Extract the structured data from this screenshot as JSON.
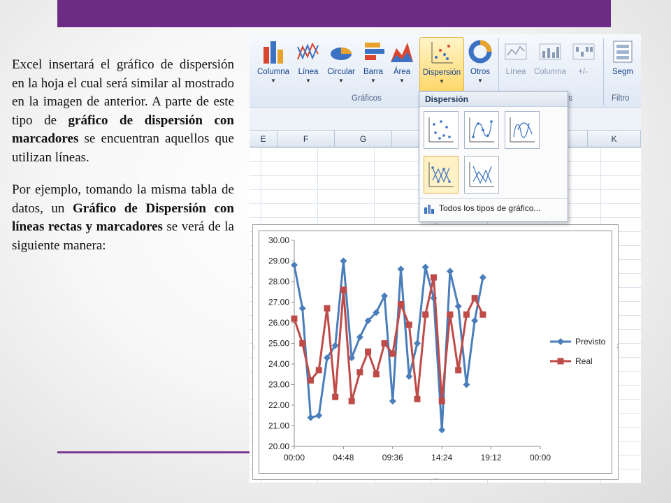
{
  "slide": {
    "paragraph1": [
      {
        "text": "Excel insertará el gráfico de dispersión en la hoja el cual será similar al mostrado en la imagen de anterior. A parte de este tipo de ",
        "bold": false
      },
      {
        "text": "gráfico de dispersión con marcadores",
        "bold": true
      },
      {
        "text": " se encuentran aquellos que utilizan líneas.",
        "bold": false
      }
    ],
    "paragraph2": [
      {
        "text": "Por ejemplo, tomando la misma tabla de datos, un ",
        "bold": false
      },
      {
        "text": "Gráfico de Dispersión con líneas rectas y marcadores",
        "bold": true
      },
      {
        "text": " se verá de la siguiente manera:",
        "bold": false
      }
    ],
    "accent_color": "#6c2c85"
  },
  "ribbon": {
    "buttons": [
      "Columna",
      "Línea",
      "Circular",
      "Barra",
      "Área",
      "Dispersión",
      "Otros"
    ],
    "sparklines": [
      "Línea",
      "Columna",
      "+/-"
    ],
    "filter_button": "Segm",
    "group_charts": "Gráficos",
    "group_sparklines_tail": "os",
    "group_filter": "Filtro"
  },
  "columns": [
    "E",
    "F",
    "G",
    "K"
  ],
  "dropdown": {
    "title": "Dispersión",
    "all_types_link": "Todos los tipos de gráfico..."
  },
  "chart_data": {
    "type": "line",
    "x": [
      "00:00",
      "00:48",
      "01:36",
      "02:24",
      "03:12",
      "04:00",
      "04:48",
      "05:36",
      "06:24",
      "07:12",
      "08:00",
      "08:48",
      "09:36",
      "10:24",
      "11:12",
      "12:00",
      "12:48",
      "13:36",
      "14:24",
      "15:12",
      "16:00",
      "16:48",
      "17:36",
      "18:24",
      "19:12",
      "20:00",
      "20:48",
      "21:36",
      "22:24",
      "23:12",
      "24:00"
    ],
    "x_tick_labels": [
      "00:00",
      "04:48",
      "09:36",
      "14:24",
      "19:12",
      "00:00"
    ],
    "y_tick_labels": [
      "20.00",
      "21.00",
      "22.00",
      "23.00",
      "24.00",
      "25.00",
      "26.00",
      "27.00",
      "28.00",
      "29.00",
      "30.00"
    ],
    "ylim": [
      20,
      30
    ],
    "series": [
      {
        "name": "Previsto",
        "color": "#4a7ebb",
        "marker": "diamond",
        "values": [
          28.8,
          26.7,
          21.4,
          21.5,
          24.3,
          24.9,
          29.0,
          24.3,
          25.3,
          26.1,
          26.5,
          27.3,
          22.2,
          28.6,
          23.4,
          25.0,
          28.7,
          27.2,
          20.8,
          28.5,
          26.8,
          23.0,
          26.1,
          28.2
        ]
      },
      {
        "name": "Real",
        "color": "#be4b48",
        "marker": "square",
        "values": [
          26.2,
          25.0,
          23.2,
          23.7,
          26.7,
          22.4,
          27.6,
          22.2,
          23.6,
          24.6,
          23.5,
          25.0,
          24.5,
          26.9,
          25.9,
          22.3,
          26.4,
          28.2,
          22.2,
          26.4,
          23.7,
          26.4,
          27.2,
          26.4
        ]
      }
    ],
    "legend_position": "right",
    "grid": false
  }
}
